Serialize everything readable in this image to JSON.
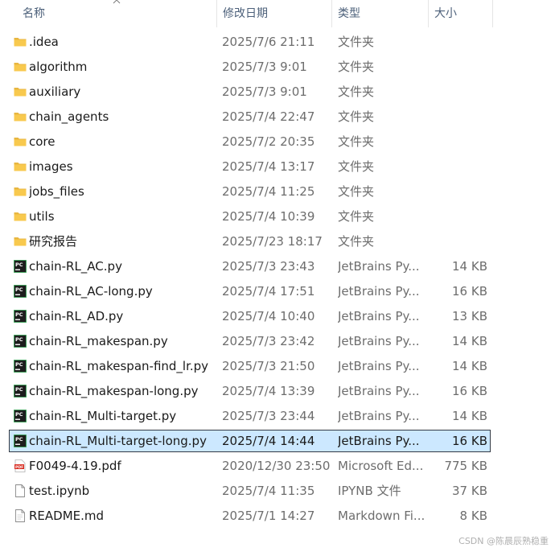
{
  "header": {
    "name": "名称",
    "date": "修改日期",
    "type": "类型",
    "size": "大小"
  },
  "files": [
    {
      "name": ".idea",
      "date": "2025/7/6 21:11",
      "type": "文件夹",
      "size": "",
      "icon": "folder-icon"
    },
    {
      "name": "algorithm",
      "date": "2025/7/3 9:01",
      "type": "文件夹",
      "size": "",
      "icon": "folder-icon"
    },
    {
      "name": "auxiliary",
      "date": "2025/7/3 9:01",
      "type": "文件夹",
      "size": "",
      "icon": "folder-icon"
    },
    {
      "name": "chain_agents",
      "date": "2025/7/4 22:47",
      "type": "文件夹",
      "size": "",
      "icon": "folder-icon"
    },
    {
      "name": "core",
      "date": "2025/7/2 20:35",
      "type": "文件夹",
      "size": "",
      "icon": "folder-icon"
    },
    {
      "name": "images",
      "date": "2025/7/4 13:17",
      "type": "文件夹",
      "size": "",
      "icon": "folder-icon"
    },
    {
      "name": "jobs_files",
      "date": "2025/7/4 11:25",
      "type": "文件夹",
      "size": "",
      "icon": "folder-icon"
    },
    {
      "name": "utils",
      "date": "2025/7/4 10:39",
      "type": "文件夹",
      "size": "",
      "icon": "folder-icon"
    },
    {
      "name": "研究报告",
      "date": "2025/7/23 18:17",
      "type": "文件夹",
      "size": "",
      "icon": "folder-icon"
    },
    {
      "name": "chain-RL_AC.py",
      "date": "2025/7/3 23:43",
      "type": "JetBrains Py...",
      "size": "14 KB",
      "icon": "pycharm-file-icon"
    },
    {
      "name": "chain-RL_AC-long.py",
      "date": "2025/7/4 17:51",
      "type": "JetBrains Py...",
      "size": "16 KB",
      "icon": "pycharm-file-icon"
    },
    {
      "name": "chain-RL_AD.py",
      "date": "2025/7/4 10:40",
      "type": "JetBrains Py...",
      "size": "13 KB",
      "icon": "pycharm-file-icon"
    },
    {
      "name": "chain-RL_makespan.py",
      "date": "2025/7/3 23:42",
      "type": "JetBrains Py...",
      "size": "14 KB",
      "icon": "pycharm-file-icon"
    },
    {
      "name": "chain-RL_makespan-find_lr.py",
      "date": "2025/7/3 21:50",
      "type": "JetBrains Py...",
      "size": "14 KB",
      "icon": "pycharm-file-icon"
    },
    {
      "name": "chain-RL_makespan-long.py",
      "date": "2025/7/4 13:39",
      "type": "JetBrains Py...",
      "size": "16 KB",
      "icon": "pycharm-file-icon"
    },
    {
      "name": "chain-RL_Multi-target.py",
      "date": "2025/7/3 23:44",
      "type": "JetBrains Py...",
      "size": "14 KB",
      "icon": "pycharm-file-icon"
    },
    {
      "name": "chain-RL_Multi-target-long.py",
      "date": "2025/7/4 14:44",
      "type": "JetBrains Py...",
      "size": "16 KB",
      "icon": "pycharm-file-icon",
      "selected": true
    },
    {
      "name": "F0049-4.19.pdf",
      "date": "2020/12/30 23:50",
      "type": "Microsoft Ed...",
      "size": "775 KB",
      "icon": "pdf-file-icon"
    },
    {
      "name": "test.ipynb",
      "date": "2025/7/4 11:35",
      "type": "IPYNB 文件",
      "size": "37 KB",
      "icon": "blank-file-icon"
    },
    {
      "name": "README.md",
      "date": "2025/7/1 14:27",
      "type": "Markdown Fi...",
      "size": "8 KB",
      "icon": "markdown-file-icon"
    }
  ],
  "watermark": "CSDN @陈晨辰熟稳重",
  "colors": {
    "header_text": "#4c607a",
    "selection_bg": "#cce8ff",
    "selection_border": "#333a44",
    "folder": "#f8c94e",
    "pdf": "#d93025"
  }
}
